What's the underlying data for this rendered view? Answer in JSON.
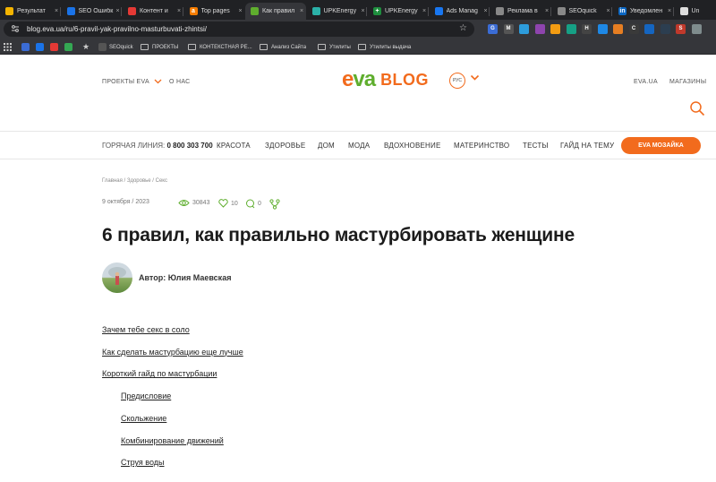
{
  "browser": {
    "tabs": [
      {
        "title": "Результат",
        "fav_color": "#f4b400",
        "fav_glyph": ""
      },
      {
        "title": "SEO Ошибк",
        "fav_color": "#1a73e8",
        "fav_glyph": ""
      },
      {
        "title": "Контент и",
        "fav_color": "#e53935",
        "fav_glyph": ""
      },
      {
        "title": "Top pages",
        "fav_color": "#f57c00",
        "fav_glyph": "a"
      },
      {
        "title": "Как правил",
        "fav_color": "#5fae2e",
        "fav_glyph": ""
      },
      {
        "title": "UPKEnergy",
        "fav_color": "#2bb1a8",
        "fav_glyph": ""
      },
      {
        "title": "UPKEnergy",
        "fav_color": "#1e8e3e",
        "fav_glyph": "+"
      },
      {
        "title": "Ads Manag",
        "fav_color": "#1877f2",
        "fav_glyph": ""
      },
      {
        "title": "Реклама в",
        "fav_color": "#888888",
        "fav_glyph": ""
      },
      {
        "title": "SEOquick",
        "fav_color": "#888888",
        "fav_glyph": ""
      },
      {
        "title": "Уведомлен",
        "fav_color": "#0a66c2",
        "fav_glyph": "in"
      },
      {
        "title": "Un",
        "fav_color": "#dddddd",
        "fav_glyph": ""
      }
    ],
    "url": "blog.eva.ua/ru/6-pravil-yak-pravilno-masturbuvati-zhintsi/",
    "extensions": [
      {
        "glyph": "G",
        "color": "#3b6cd4"
      },
      {
        "glyph": "M",
        "color": "#555555"
      },
      {
        "glyph": "",
        "color": "#2d9cdb"
      },
      {
        "glyph": "",
        "color": "#8e44ad"
      },
      {
        "glyph": "",
        "color": "#f39c12"
      },
      {
        "glyph": "",
        "color": "#16a085"
      },
      {
        "glyph": "H",
        "color": "#444444"
      },
      {
        "glyph": "",
        "color": "#1e88e5"
      },
      {
        "glyph": "",
        "color": "#e67e22"
      },
      {
        "glyph": "C",
        "color": "#3a3a3a"
      },
      {
        "glyph": "",
        "color": "#1565c0"
      },
      {
        "glyph": "",
        "color": "#2c3e50"
      },
      {
        "glyph": "S",
        "color": "#c0392b"
      },
      {
        "glyph": "",
        "color": "#7f8c8d"
      }
    ],
    "bookmarks": [
      {
        "label": "SEOquick",
        "type": "site"
      },
      {
        "label": "ПРОЕКТЫ",
        "type": "folder"
      },
      {
        "label": "КОНТЕКСТНАЯ РЕ...",
        "type": "folder"
      },
      {
        "label": "Анализ Сайта",
        "type": "folder"
      },
      {
        "label": "Утилиты",
        "type": "folder"
      },
      {
        "label": "Утилиты выдача",
        "type": "folder"
      }
    ]
  },
  "site": {
    "colors": {
      "accent": "#f26b1d",
      "green": "#5fae2e"
    },
    "projects_label": "ПРОЕКТЫ EVA",
    "about_label": "О НАС",
    "logo_text": "eva",
    "logo_blog": "BLOG",
    "lang_label": "РУС",
    "eva_ua_label": "EVA.UA",
    "stores_label": "МАГАЗИНЫ",
    "hotline_label": "ГОРЯЧАЯ ЛИНИЯ:",
    "hotline_number": "0 800 303 700",
    "nav": [
      "КРАСОТА",
      "ЗДОРОВЬЕ",
      "ДОМ",
      "МОДА",
      "ВДОХНОВЕНИЕ",
      "МАТЕРИНСТВО",
      "ТЕСТЫ",
      "ГАЙД НА ТЕМУ"
    ],
    "mosaic_label": "EVA МОЗАЙКА"
  },
  "article": {
    "breadcrumb": "Главная / Здоровье / Секс",
    "date": "9 октября / 2023",
    "views": "30843",
    "likes": "10",
    "comments": "0",
    "title": "6 правил, как правильно мастурбировать женщине",
    "author": "Автор: Юлия Маевская",
    "toc": [
      {
        "label": "Зачем тебе секс в соло",
        "level": 1
      },
      {
        "label": "Как сделать мастурбацию еще лучше",
        "level": 1
      },
      {
        "label": "Короткий гайд по мастурбации",
        "level": 1
      },
      {
        "label": "Предисловие",
        "level": 2
      },
      {
        "label": "Скольжение",
        "level": 2
      },
      {
        "label": "Комбинирование движений",
        "level": 2
      },
      {
        "label": "Струя воды",
        "level": 2
      }
    ]
  }
}
